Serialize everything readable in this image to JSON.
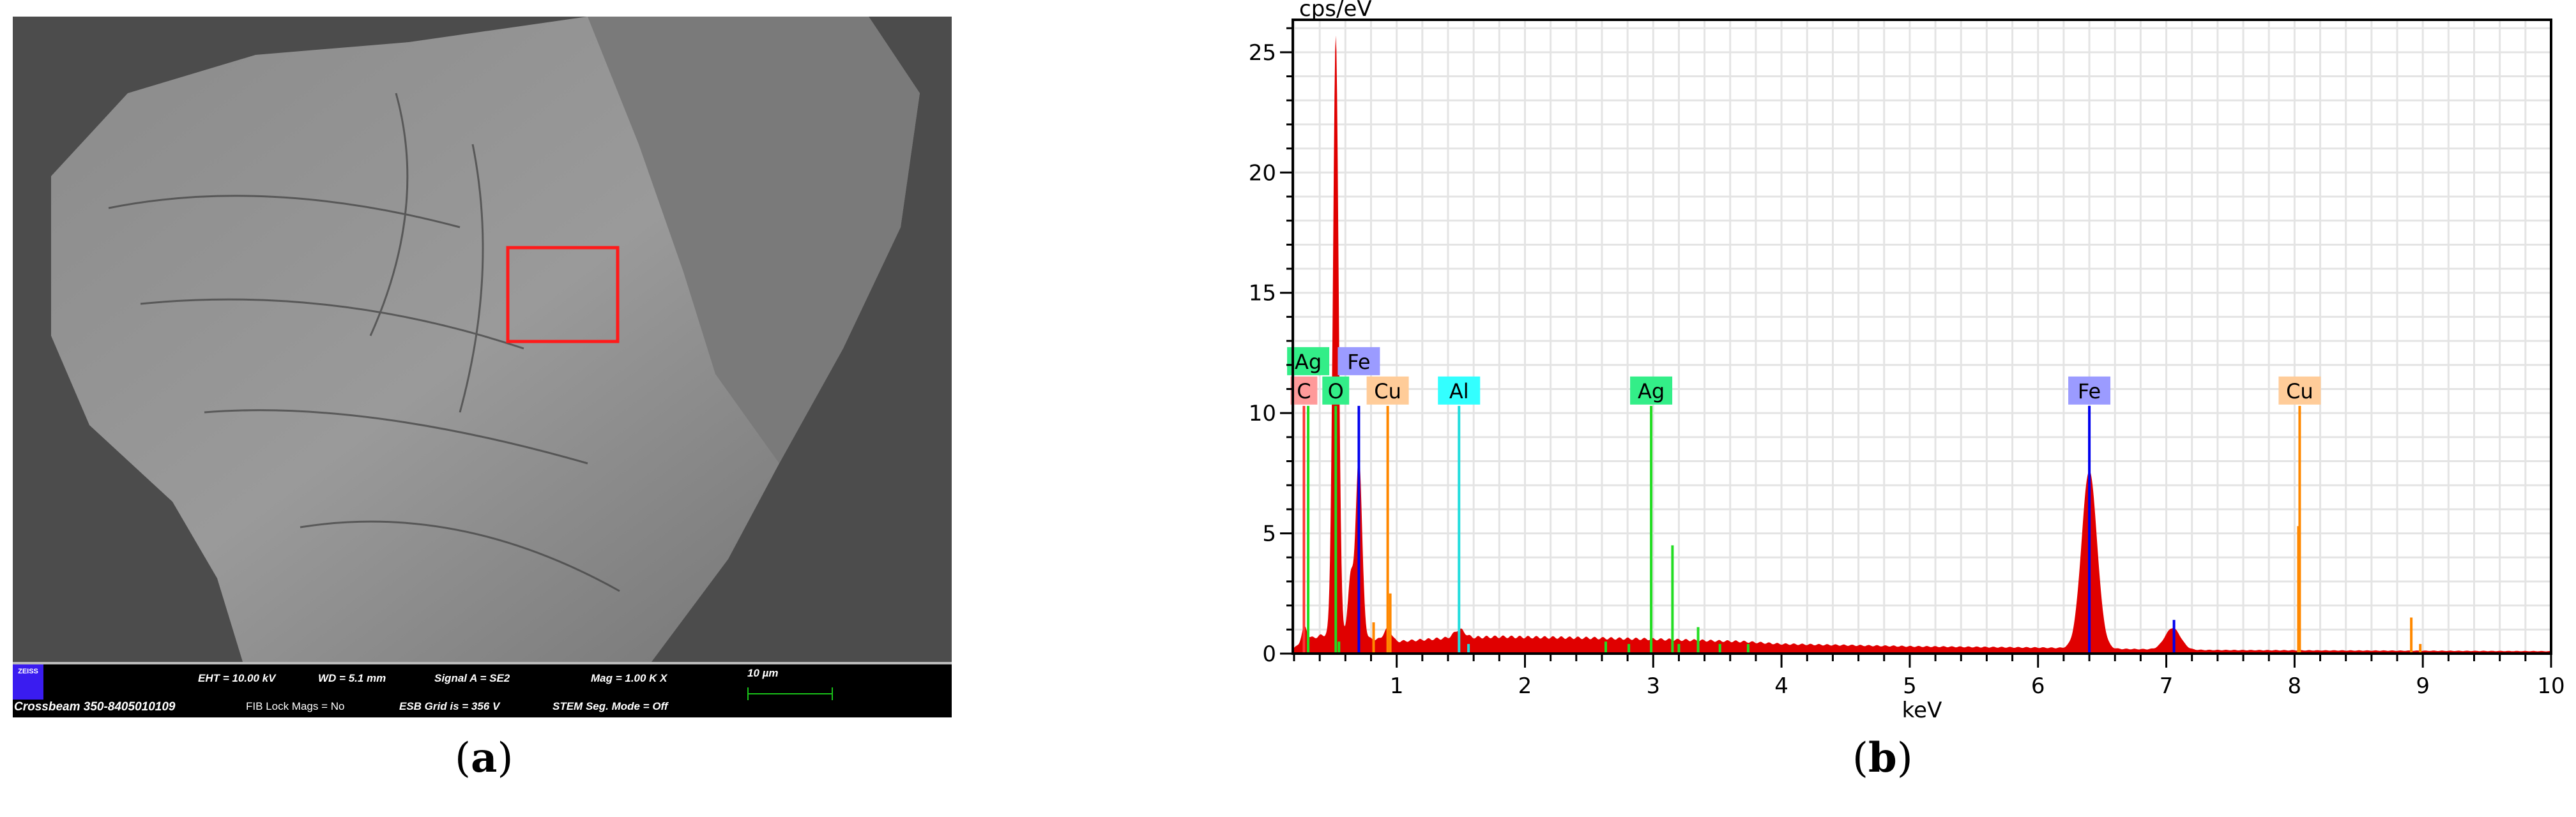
{
  "panel_a": {
    "caption_letter": "a",
    "infobar": {
      "logo": "ZEISS",
      "eht": "EHT = 10.00 kV",
      "wd": "WD =  5.1 mm",
      "signal": "Signal A = SE2",
      "mag": "Mag =   1.00 K X",
      "scale": "10 µm",
      "instrument": "Crossbeam 350-8405010109",
      "fib": "FIB Lock Mags = No",
      "esb": "ESB Grid is =   356 V",
      "stem": "STEM Seg. Mode = Off"
    },
    "colors": {
      "roi": "#ff1a1a",
      "scalebar": "#19c219"
    }
  },
  "panel_b": {
    "caption_letter": "b"
  },
  "chart_data": {
    "type": "area",
    "title": "",
    "xlabel": "keV",
    "ylabel": "cps/eV",
    "xlim": [
      0.19,
      10
    ],
    "ylim": [
      0,
      26.35
    ],
    "xticks": [
      1,
      2,
      3,
      4,
      5,
      6,
      7,
      8,
      9,
      10
    ],
    "yticks": [
      0,
      5,
      10,
      15,
      20,
      25
    ],
    "grid": true,
    "spectrum": {
      "color": "#e00000",
      "background": [
        [
          0.19,
          0.2
        ],
        [
          0.3,
          0.6
        ],
        [
          0.45,
          0.8
        ],
        [
          1.0,
          0.5
        ],
        [
          1.4,
          0.65
        ],
        [
          1.8,
          0.7
        ],
        [
          2.5,
          0.65
        ],
        [
          3.0,
          0.6
        ],
        [
          3.7,
          0.5
        ],
        [
          4.0,
          0.4
        ],
        [
          5.0,
          0.3
        ],
        [
          6.0,
          0.25
        ],
        [
          6.6,
          0.2
        ],
        [
          7.3,
          0.15
        ],
        [
          10,
          0.1
        ]
      ],
      "peaks": [
        {
          "keV": 0.525,
          "height": 24.9,
          "width": 0.022
        },
        {
          "keV": 0.28,
          "height": 0.6,
          "width": 0.02
        },
        {
          "keV": 0.64,
          "height": 2.5,
          "width": 0.02
        },
        {
          "keV": 0.705,
          "height": 7.6,
          "width": 0.025
        },
        {
          "keV": 0.93,
          "height": 0.5,
          "width": 0.03
        },
        {
          "keV": 1.49,
          "height": 0.35,
          "width": 0.04
        },
        {
          "keV": 6.4,
          "height": 7.4,
          "width": 0.06
        },
        {
          "keV": 7.05,
          "height": 0.9,
          "width": 0.06
        }
      ]
    },
    "markers": [
      {
        "element": "C",
        "keV": 0.277,
        "height": 10.3,
        "color": "#ff3333",
        "label_bg": "#ff9a9a",
        "row": 1
      },
      {
        "element": "Ag",
        "keV": 0.31,
        "height": 10.3,
        "color": "#22dd22",
        "label_bg": "#33ee88",
        "row": 2
      },
      {
        "element": "O",
        "keV": 0.525,
        "height": 10.3,
        "color": "#22dd22",
        "label_bg": "#33ee88",
        "row": 1
      },
      {
        "element": "Fe",
        "keV": 0.705,
        "height": 10.3,
        "color": "#0000ee",
        "label_bg": "#9b9bff",
        "row": 2
      },
      {
        "element": "Cu",
        "keV": 0.93,
        "height": 10.3,
        "color": "#ff8800",
        "label_bg": "#ffcc99",
        "row": 1
      },
      {
        "element": "Al",
        "keV": 1.486,
        "height": 10.3,
        "color": "#22dddd",
        "label_bg": "#33ffff",
        "row": 1
      },
      {
        "element": "Ag",
        "keV": 2.984,
        "height": 10.3,
        "color": "#22dd22",
        "label_bg": "#33ee88",
        "row": 1
      },
      {
        "element": "Fe",
        "keV": 6.4,
        "height": 10.3,
        "color": "#0000ee",
        "label_bg": "#9b9bff",
        "row": 1
      },
      {
        "element": "Cu",
        "keV": 8.04,
        "height": 10.3,
        "color": "#ff8800",
        "label_bg": "#ffcc99",
        "row": 1
      }
    ],
    "minor_lines": [
      {
        "keV": 0.55,
        "height": 0.5,
        "color": "#22dd22"
      },
      {
        "keV": 0.82,
        "height": 1.3,
        "color": "#ff8800"
      },
      {
        "keV": 0.95,
        "height": 2.5,
        "color": "#ff8800"
      },
      {
        "keV": 1.56,
        "height": 0.4,
        "color": "#22dddd"
      },
      {
        "keV": 2.63,
        "height": 0.5,
        "color": "#22dd22"
      },
      {
        "keV": 2.81,
        "height": 0.4,
        "color": "#22dd22"
      },
      {
        "keV": 3.15,
        "height": 4.5,
        "color": "#22dd22"
      },
      {
        "keV": 3.2,
        "height": 0.4,
        "color": "#22dd22"
      },
      {
        "keV": 3.35,
        "height": 1.1,
        "color": "#22dd22"
      },
      {
        "keV": 3.52,
        "height": 0.4,
        "color": "#22dd22"
      },
      {
        "keV": 3.74,
        "height": 0.4,
        "color": "#22dd22"
      },
      {
        "keV": 7.06,
        "height": 1.4,
        "color": "#0000ee"
      },
      {
        "keV": 8.03,
        "height": 5.3,
        "color": "#ff8800"
      },
      {
        "keV": 8.91,
        "height": 1.5,
        "color": "#ff8800"
      },
      {
        "keV": 8.98,
        "height": 0.4,
        "color": "#ff8800"
      }
    ]
  }
}
